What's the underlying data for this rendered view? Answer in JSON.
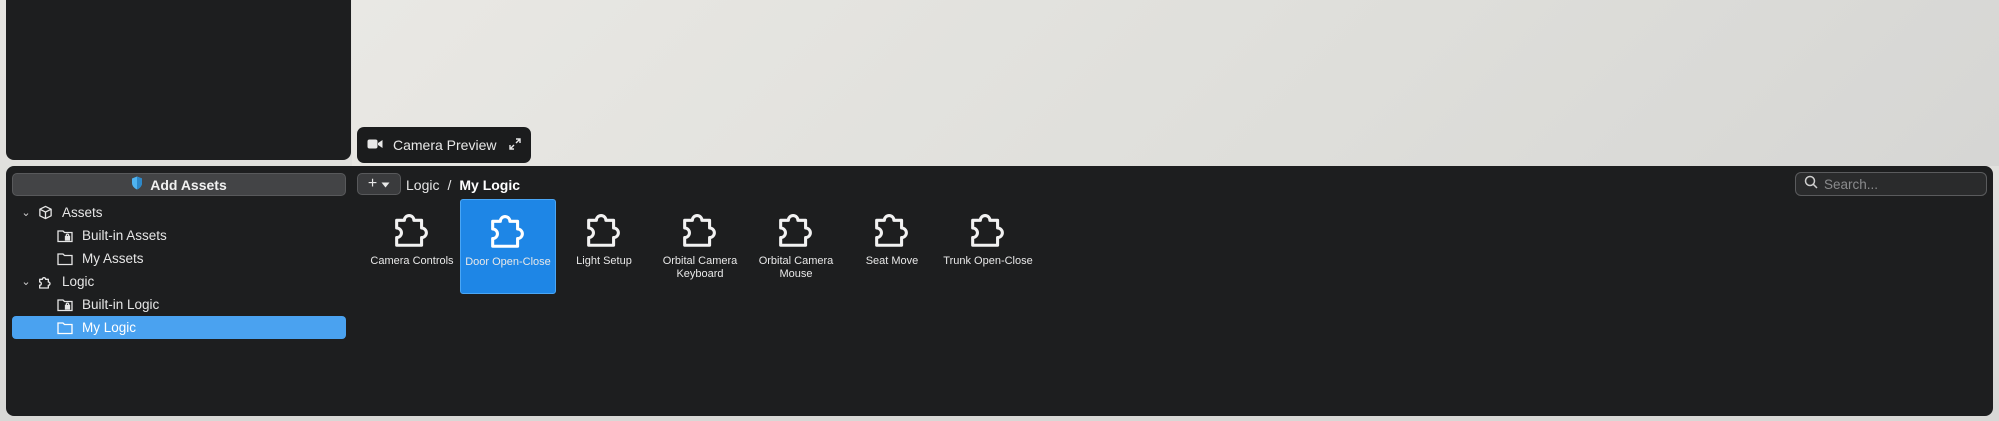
{
  "camera_preview": {
    "label": "Camera Preview"
  },
  "sidebar": {
    "add_assets_label": "Add Assets",
    "tree": [
      {
        "label": "Assets",
        "icon": "cube-icon",
        "level": 0,
        "expanded": true
      },
      {
        "label": "Built-in Assets",
        "icon": "locked-folder-icon",
        "level": 1
      },
      {
        "label": "My Assets",
        "icon": "folder-icon",
        "level": 1
      },
      {
        "label": "Logic",
        "icon": "puzzle-icon",
        "level": 0,
        "expanded": true
      },
      {
        "label": "Built-in Logic",
        "icon": "locked-folder-icon",
        "level": 1
      },
      {
        "label": "My Logic",
        "icon": "folder-icon",
        "level": 1,
        "selected": true
      }
    ]
  },
  "toolbar": {
    "plus_label": "+"
  },
  "breadcrumb": {
    "root": "Logic",
    "separator": "/",
    "current": "My Logic"
  },
  "search": {
    "placeholder": "Search..."
  },
  "items": [
    {
      "name": "Camera Controls",
      "icon": "puzzle-icon"
    },
    {
      "name": "Door Open-Close",
      "icon": "puzzle-icon",
      "selected": true
    },
    {
      "name": "Light Setup",
      "icon": "puzzle-icon"
    },
    {
      "name": "Orbital Camera Keyboard",
      "icon": "puzzle-icon"
    },
    {
      "name": "Orbital Camera Mouse",
      "icon": "puzzle-icon"
    },
    {
      "name": "Seat Move",
      "icon": "puzzle-icon"
    },
    {
      "name": "Trunk Open-Close",
      "icon": "puzzle-icon"
    }
  ],
  "colors": {
    "accent": "#1e86e6",
    "selection": "#4aa2f0",
    "panel": "#1d1e1f"
  }
}
